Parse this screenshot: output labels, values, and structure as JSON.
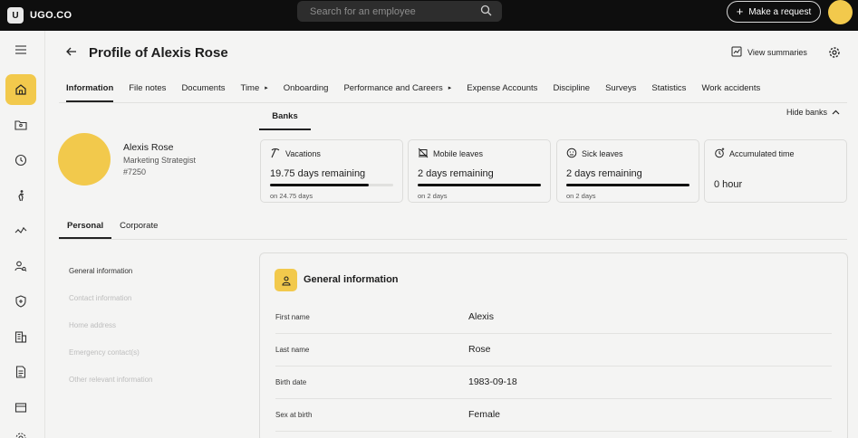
{
  "brand": {
    "badge": "U",
    "name": "UGO.CO"
  },
  "search": {
    "placeholder": "Search for an employee"
  },
  "top": {
    "request_label": "Make a request"
  },
  "header": {
    "title": "Profile of Alexis Rose",
    "view_summaries": "View summaries"
  },
  "tabs": [
    {
      "label": "Information",
      "active": true
    },
    {
      "label": "File notes"
    },
    {
      "label": "Documents"
    },
    {
      "label": "Time",
      "arrow": "▸"
    },
    {
      "label": "Onboarding"
    },
    {
      "label": "Performance and Careers",
      "arrow": "▸"
    },
    {
      "label": "Expense Accounts"
    },
    {
      "label": "Discipline"
    },
    {
      "label": "Surveys"
    },
    {
      "label": "Statistics"
    },
    {
      "label": "Work accidents"
    }
  ],
  "banks": {
    "tab_label": "Banks",
    "hide_label": "Hide banks",
    "cards": [
      {
        "icon": "pickaxe-icon",
        "title": "Vacations",
        "main": "19.75 days remaining",
        "progress": 0.8,
        "sub": "on 24.75 days"
      },
      {
        "icon": "no-laptop-icon",
        "title": "Mobile leaves",
        "main": "2 days remaining",
        "progress": 1.0,
        "sub": "on 2 days"
      },
      {
        "icon": "sick-face-icon",
        "title": "Sick leaves",
        "main": "2 days remaining",
        "progress": 1.0,
        "sub": "on 2 days"
      },
      {
        "icon": "clock-plus-icon",
        "title": "Accumulated time",
        "main": "0 hour"
      }
    ]
  },
  "employee": {
    "name": "Alexis Rose",
    "role": "Marketing Strategist",
    "id": "#7250"
  },
  "sub_tabs": [
    {
      "label": "Personal",
      "active": true
    },
    {
      "label": "Corporate"
    }
  ],
  "section_nav": [
    {
      "label": "General information",
      "active": true
    },
    {
      "label": "Contact information"
    },
    {
      "label": "Home address"
    },
    {
      "label": "Emergency contact(s)"
    },
    {
      "label": "Other relevant information"
    }
  ],
  "general": {
    "title": "General information",
    "fields": [
      {
        "label": "First name",
        "value": "Alexis"
      },
      {
        "label": "Last name",
        "value": "Rose"
      },
      {
        "label": "Birth date",
        "value": "1983-09-18"
      },
      {
        "label": "Sex at birth",
        "value": "Female"
      }
    ]
  },
  "colors": {
    "accent": "#f2c94c",
    "topbar": "#0e0e0e",
    "background": "#f4f4f3"
  }
}
